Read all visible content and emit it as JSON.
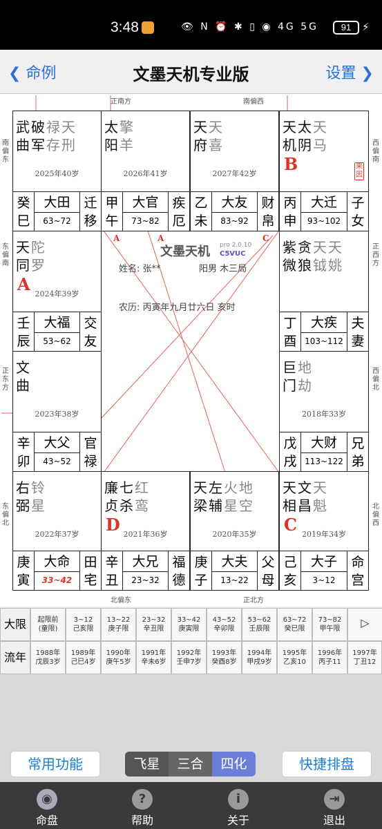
{
  "status": {
    "time": "3:48",
    "icons": "👁 N ⏰ ✱ ▯ ◉ 4G 5G",
    "battery": "91"
  },
  "nav": {
    "back": "命例",
    "title": "文墨天机专业版",
    "settings": "设置"
  },
  "directions": {
    "top_south": "正南方",
    "top_sw": "南偏西",
    "left_se": "南偏东",
    "left_es": "东偏南",
    "left_east": "正东方",
    "left_en": "东偏北",
    "right_ws": "西偏南",
    "right_west": "正西方",
    "right_wn": "西偏北",
    "right_nw": "北偏西",
    "bottom_ne": "北偏东",
    "bottom_north": "正北方"
  },
  "palaces": [
    {
      "stars": [
        {
          "t": "武曲",
          "c": "#111"
        },
        {
          "t": "破军",
          "c": "#111"
        },
        {
          "t": "禄存",
          "c": "#888"
        },
        {
          "t": "天刑",
          "c": "#888"
        }
      ],
      "age": "2025年40岁",
      "gz": "癸巳",
      "dx": "大田",
      "range": "63~72",
      "pn": "迁移"
    },
    {
      "stars": [
        {
          "t": "太阳",
          "c": "#111"
        },
        {
          "t": "擎羊",
          "c": "#888"
        }
      ],
      "age": "2026年41岁",
      "gz": "甲午",
      "dx": "大官",
      "range": "73~82",
      "pn": "疾厄"
    },
    {
      "stars": [
        {
          "t": "天府",
          "c": "#111"
        },
        {
          "t": "天喜",
          "c": "#888"
        }
      ],
      "age": "2027年42岁",
      "gz": "乙未",
      "dx": "大友",
      "range": "83~92",
      "pn": "财帛"
    },
    {
      "stars": [
        {
          "t": "天机",
          "c": "#111"
        },
        {
          "t": "太阴",
          "c": "#111"
        },
        {
          "t": "天马",
          "c": "#888"
        }
      ],
      "age": "",
      "gz": "丙申",
      "dx": "大迁",
      "range": "93~102",
      "pn": "子女",
      "sihua": "B",
      "badge": "来因"
    },
    {
      "stars": [
        {
          "t": "天同",
          "c": "#111"
        },
        {
          "t": "陀罗",
          "c": "#888"
        }
      ],
      "age": "2024年39岁",
      "gz": "壬辰",
      "dx": "大福",
      "range": "53~62",
      "pn": "交友",
      "sihua": "A"
    },
    {
      "stars": [
        {
          "t": "紫微",
          "c": "#111"
        },
        {
          "t": "贪狼",
          "c": "#111"
        },
        {
          "t": "天钺",
          "c": "#888"
        },
        {
          "t": "天姚",
          "c": "#888"
        }
      ],
      "age": "",
      "gz": "丁酉",
      "dx": "大疾",
      "range": "103~112",
      "pn": "夫妻"
    },
    {
      "stars": [
        {
          "t": "文曲",
          "c": "#111"
        }
      ],
      "age": "2023年38岁",
      "gz": "辛卯",
      "dx": "大父",
      "range": "43~52",
      "pn": "官禄"
    },
    {
      "stars": [
        {
          "t": "巨门",
          "c": "#111"
        },
        {
          "t": "地劫",
          "c": "#888"
        }
      ],
      "age": "2018年33岁",
      "gz": "戊戌",
      "dx": "大财",
      "range": "113~122",
      "pn": "兄弟"
    },
    {
      "stars": [
        {
          "t": "右弼",
          "c": "#111"
        },
        {
          "t": "铃星",
          "c": "#888"
        }
      ],
      "age": "2022年37岁",
      "gz": "庚寅",
      "dx": "大命",
      "range": "33~42",
      "pn": "田宅",
      "highlight": true
    },
    {
      "stars": [
        {
          "t": "廉贞",
          "c": "#111"
        },
        {
          "t": "七杀",
          "c": "#111"
        },
        {
          "t": "红鸾",
          "c": "#888"
        }
      ],
      "age": "2021年36岁",
      "gz": "辛丑",
      "dx": "大兄",
      "range": "23~32",
      "pn": "福德",
      "sihua": "D"
    },
    {
      "stars": [
        {
          "t": "天梁",
          "c": "#111"
        },
        {
          "t": "左辅",
          "c": "#111"
        },
        {
          "t": "火星",
          "c": "#888"
        },
        {
          "t": "地空",
          "c": "#888"
        }
      ],
      "age": "2020年35岁",
      "gz": "庚子",
      "dx": "大夫",
      "range": "13~22",
      "pn": "父母"
    },
    {
      "stars": [
        {
          "t": "天相",
          "c": "#111"
        },
        {
          "t": "文昌",
          "c": "#111"
        },
        {
          "t": "天魁",
          "c": "#888"
        }
      ],
      "age": "2019年34岁",
      "gz": "己亥",
      "dx": "大子",
      "range": "3~12",
      "pn": "命宫",
      "sihua": "C"
    }
  ],
  "center": {
    "logo": "文墨天机",
    "version": "pro 2.0.10",
    "code": "C5VUC",
    "name": "姓名: 张**",
    "info": "阳男 木三局",
    "lunar": "农历: 丙寅年九月廿六日 亥时"
  },
  "flight_labels": {
    "a1": "A",
    "a2": "A",
    "a3": "A",
    "b": "B",
    "c1": "C",
    "c2": "C",
    "d": "D"
  },
  "timeline": {
    "daxian_label": "大限",
    "liunian_label": "流年",
    "next": "▷",
    "daxian": [
      [
        "起限前",
        "(童限)"
      ],
      [
        "3~12",
        "己亥限"
      ],
      [
        "13~22",
        "庚子限"
      ],
      [
        "23~32",
        "辛丑限"
      ],
      [
        "33~42",
        "庚寅限"
      ],
      [
        "43~52",
        "辛卯限"
      ],
      [
        "53~62",
        "壬辰限"
      ],
      [
        "63~72",
        "癸巳限"
      ],
      [
        "73~82",
        "甲午限"
      ]
    ],
    "liunian": [
      [
        "1988年",
        "戊辰3岁"
      ],
      [
        "1989年",
        "己巳4岁"
      ],
      [
        "1990年",
        "庚午5岁"
      ],
      [
        "1991年",
        "辛未6岁"
      ],
      [
        "1992年",
        "壬申7岁"
      ],
      [
        "1993年",
        "癸酉8岁"
      ],
      [
        "1994年",
        "甲戌9岁"
      ],
      [
        "1995年",
        "乙亥10"
      ],
      [
        "1996年",
        "丙子11"
      ],
      [
        "1997年",
        "丁丑12"
      ]
    ]
  },
  "buttons": {
    "common": "常用功能",
    "quick": "快捷排盘",
    "seg": [
      "飞星",
      "三合",
      "四化"
    ]
  },
  "tabs": [
    "命盘",
    "帮助",
    "关于",
    "退出"
  ],
  "colors": {
    "accent": "#2a6fd6",
    "sihua": "#d9352a",
    "segment": "#6b7fd8"
  }
}
